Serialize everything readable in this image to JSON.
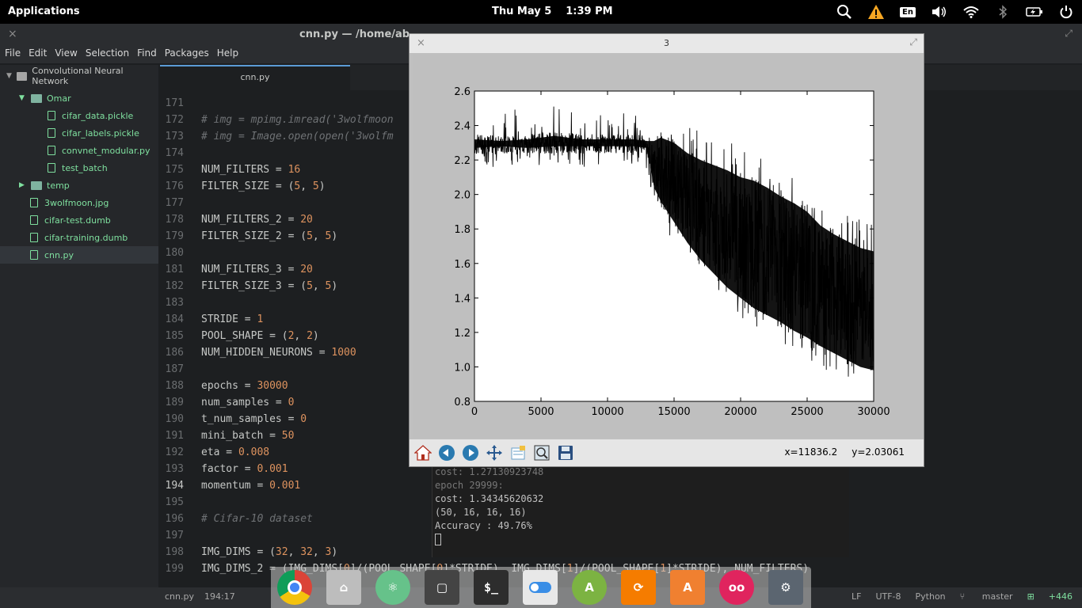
{
  "top_panel": {
    "apps_label": "Applications",
    "day": "Thu May 5",
    "time": "1:39 PM",
    "tray": [
      "search-icon",
      "warning-icon",
      "keyboard-layout",
      "volume-icon",
      "wifi-icon",
      "bluetooth-icon",
      "battery-icon",
      "power-icon"
    ],
    "keyboard_layout": "En"
  },
  "atom": {
    "title": "cnn.py — /home/abdula",
    "menu": [
      "File",
      "Edit",
      "View",
      "Selection",
      "Find",
      "Packages",
      "Help"
    ],
    "tab": "cnn.py"
  },
  "tree": {
    "items": [
      {
        "label": "Convolutional Neural Network",
        "kind": "root"
      },
      {
        "label": "Omar",
        "kind": "folder-open"
      },
      {
        "label": "cifar_data.pickle",
        "kind": "file"
      },
      {
        "label": "cifar_labels.pickle",
        "kind": "file"
      },
      {
        "label": "convnet_modular.py",
        "kind": "file"
      },
      {
        "label": "test_batch",
        "kind": "file"
      },
      {
        "label": "temp",
        "kind": "folder-closed"
      },
      {
        "label": "3wolfmoon.jpg",
        "kind": "file"
      },
      {
        "label": "cifar-test.dumb",
        "kind": "file"
      },
      {
        "label": "cifar-training.dumb",
        "kind": "file"
      },
      {
        "label": "cnn.py",
        "kind": "file"
      }
    ]
  },
  "editor": {
    "lines": [
      {
        "n": "171",
        "t": ""
      },
      {
        "n": "172",
        "t": "# img = mpimg.imread('3wolfmoon"
      },
      {
        "n": "173",
        "t": "# img = Image.open(open('3wolfm"
      },
      {
        "n": "174",
        "t": ""
      },
      {
        "n": "175",
        "t": "NUM_FILTERS = 16"
      },
      {
        "n": "176",
        "t": "FILTER_SIZE = (5, 5)"
      },
      {
        "n": "177",
        "t": ""
      },
      {
        "n": "178",
        "t": "NUM_FILTERS_2 = 20"
      },
      {
        "n": "179",
        "t": "FILTER_SIZE_2 = (5, 5)"
      },
      {
        "n": "180",
        "t": ""
      },
      {
        "n": "181",
        "t": "NUM_FILTERS_3 = 20"
      },
      {
        "n": "182",
        "t": "FILTER_SIZE_3 = (5, 5)"
      },
      {
        "n": "183",
        "t": ""
      },
      {
        "n": "184",
        "t": "STRIDE = 1"
      },
      {
        "n": "185",
        "t": "POOL_SHAPE = (2, 2)"
      },
      {
        "n": "186",
        "t": "NUM_HIDDEN_NEURONS = 1000"
      },
      {
        "n": "187",
        "t": ""
      },
      {
        "n": "188",
        "t": "epochs = 30000"
      },
      {
        "n": "189",
        "t": "num_samples = 0"
      },
      {
        "n": "190",
        "t": "t_num_samples = 0"
      },
      {
        "n": "191",
        "t": "mini_batch = 50"
      },
      {
        "n": "192",
        "t": "eta = 0.008"
      },
      {
        "n": "193",
        "t": "factor = 0.001"
      },
      {
        "n": "194",
        "t": "momentum = 0.001"
      },
      {
        "n": "195",
        "t": ""
      },
      {
        "n": "196",
        "t": "# Cifar-10 dataset"
      },
      {
        "n": "197",
        "t": ""
      },
      {
        "n": "198",
        "t": "IMG_DIMS = (32, 32, 3)"
      },
      {
        "n": "199",
        "t": "IMG_DIMS_2 = (IMG_DIMS[0]/(POOL_SHAPE[0]*STRIDE), IMG_DIMS[1]/(POOL_SHAPE[1]*STRIDE), NUM_FILTERS)"
      }
    ],
    "current_line": "194"
  },
  "terminal": {
    "lines": [
      "cost: 1.27130923748",
      "epoch 29999:",
      "cost: 1.34345620632",
      "(50, 16, 16, 16)",
      "Accuracy : 49.76%"
    ]
  },
  "plot_window": {
    "title": "3",
    "toolbar": [
      "home-icon",
      "back-icon",
      "forward-icon",
      "pan-icon",
      "subplots-icon",
      "zoom-rect-icon",
      "save-icon"
    ],
    "x_readout": "x=11836.2",
    "y_readout": "y=2.03061"
  },
  "chart_data": {
    "type": "line",
    "title": "",
    "xlabel": "",
    "ylabel": "",
    "xlim": [
      0,
      30000
    ],
    "ylim": [
      0.8,
      2.6
    ],
    "xticks": [
      0,
      5000,
      10000,
      15000,
      20000,
      25000,
      30000
    ],
    "yticks": [
      0.8,
      1.0,
      1.2,
      1.4,
      1.6,
      1.8,
      2.0,
      2.2,
      2.4,
      2.6
    ],
    "grid": false,
    "series": [
      {
        "color": "#000000",
        "x": [
          0,
          2000,
          4000,
          6000,
          8000,
          10000,
          12000,
          13000,
          13500,
          14000,
          15000,
          16000,
          17000,
          18000,
          19000,
          20000,
          21000,
          22000,
          23000,
          24000,
          25000,
          26000,
          27000,
          28000,
          29000,
          30000
        ],
        "upper": [
          2.35,
          2.34,
          2.35,
          2.37,
          2.35,
          2.35,
          2.35,
          2.34,
          2.34,
          2.36,
          2.33,
          2.27,
          2.23,
          2.2,
          2.17,
          2.13,
          2.11,
          2.07,
          2.02,
          1.98,
          1.93,
          1.85,
          1.8,
          1.76,
          1.72,
          1.7
        ],
        "lower": [
          2.23,
          2.24,
          2.23,
          2.24,
          2.24,
          2.24,
          2.24,
          2.23,
          2.0,
          1.92,
          1.8,
          1.68,
          1.58,
          1.5,
          1.42,
          1.36,
          1.3,
          1.26,
          1.22,
          1.17,
          1.13,
          1.08,
          1.04,
          1.0,
          0.96,
          0.94
        ]
      }
    ]
  },
  "status_bar": {
    "file": "cnn.py",
    "cursor": "194:17",
    "line_ending": "LF",
    "encoding": "UTF-8",
    "grammar": "Python",
    "branch": "master",
    "diff": "+446"
  },
  "dock": {
    "apps": [
      {
        "name": "chrome-icon",
        "color": "#dd4b39"
      },
      {
        "name": "home-folder-icon",
        "color": "#9a9a9a"
      },
      {
        "name": "atom-icon",
        "color": "#66c28a"
      },
      {
        "name": "screenshot-icon",
        "color": "#444444"
      },
      {
        "name": "terminal-icon",
        "color": "#2d2d2d"
      },
      {
        "name": "toggle-icon",
        "color": "#e8e8e8"
      },
      {
        "name": "android-studio-icon",
        "color": "#7cb342"
      },
      {
        "name": "sync-icon",
        "color": "#f57c00"
      },
      {
        "name": "store-icon",
        "color": "#f08030"
      },
      {
        "name": "flickr-icon",
        "color": "#e0245e"
      },
      {
        "name": "settings-icon",
        "color": "#5b6570"
      }
    ],
    "terminal_glyph": "$_"
  }
}
